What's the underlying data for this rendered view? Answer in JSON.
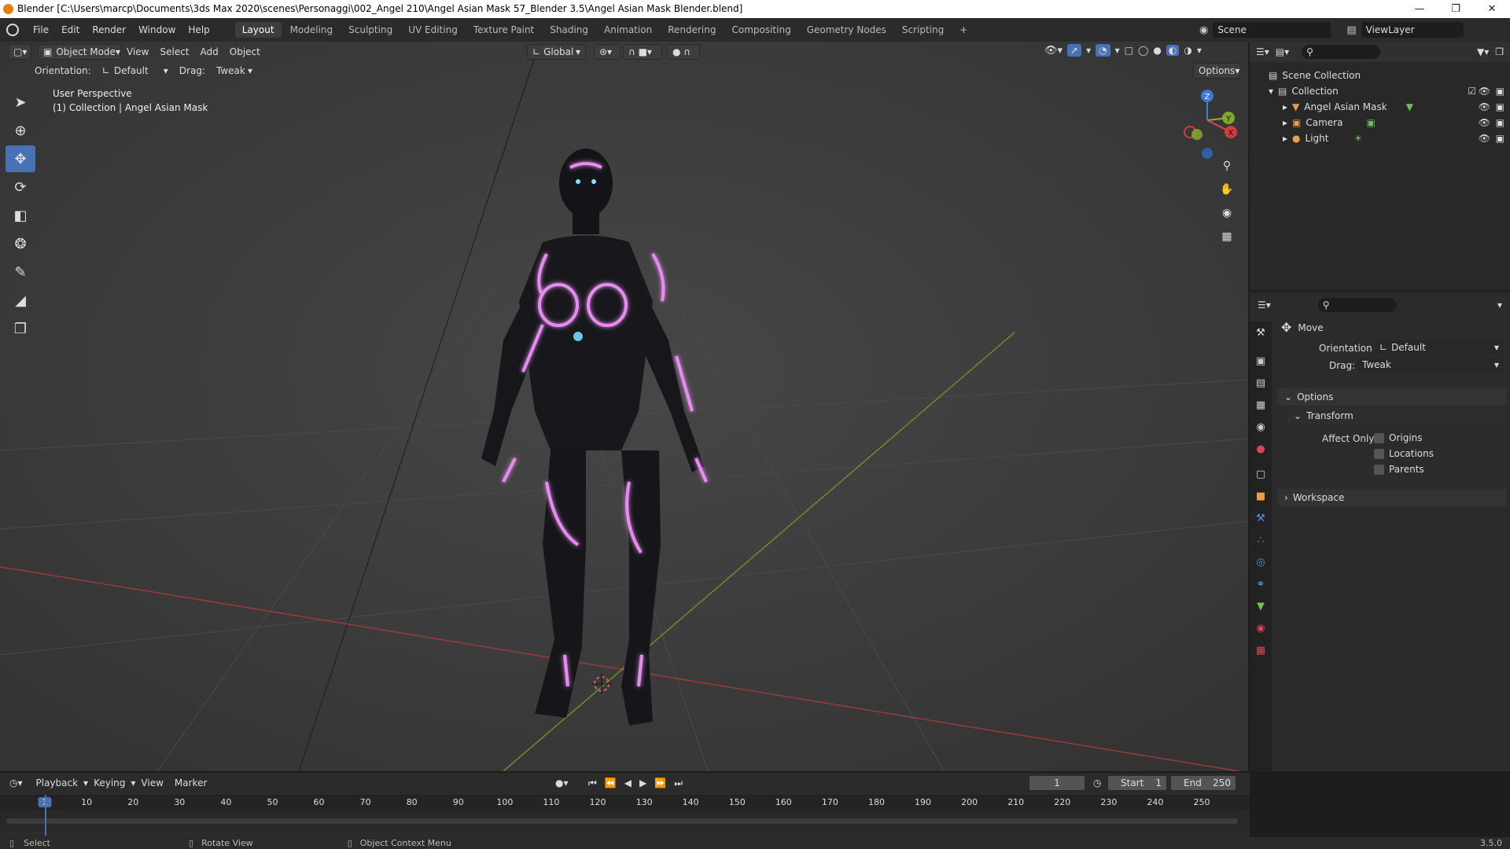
{
  "window": {
    "title": "Blender [C:\\Users\\marcp\\Documents\\3ds Max 2020\\scenes\\Personaggi\\002_Angel 210\\Angel Asian Mask 57_Blender 3.5\\Angel Asian Mask Blender.blend]"
  },
  "menu": {
    "items": [
      "File",
      "Edit",
      "Render",
      "Window",
      "Help"
    ],
    "workspaces": [
      "Layout",
      "Modeling",
      "Sculpting",
      "UV Editing",
      "Texture Paint",
      "Shading",
      "Animation",
      "Rendering",
      "Compositing",
      "Geometry Nodes",
      "Scripting",
      "+"
    ],
    "active_workspace": "Layout",
    "scene": "Scene",
    "view_layer": "ViewLayer"
  },
  "viewport": {
    "mode": "Object Mode",
    "menus": [
      "View",
      "Select",
      "Add",
      "Object"
    ],
    "transform_orientation": "Global",
    "options_label": "Options",
    "orientation_label": "Orientation:",
    "orientation_value": "Default",
    "drag_label": "Drag:",
    "drag_value": "Tweak",
    "perspective": "User Perspective",
    "collection_info": "(1) Collection | Angel Asian Mask",
    "gizmo": {
      "z": "Z",
      "y": "Y",
      "x": "X"
    }
  },
  "outliner": {
    "root": "Scene Collection",
    "collection": "Collection",
    "objects": [
      "Angel Asian Mask",
      "Camera",
      "Light"
    ]
  },
  "properties": {
    "tool_name": "Move",
    "orientation_label": "Orientation",
    "orientation_value": "Default",
    "drag_label": "Drag:",
    "drag_value": "Tweak",
    "options_section": "Options",
    "transform_section": "Transform",
    "affect_only_label": "Affect Only",
    "affect_options": [
      "Origins",
      "Locations",
      "Parents"
    ],
    "workspace_section": "Workspace"
  },
  "timeline": {
    "menus": [
      "Playback",
      "Keying",
      "View",
      "Marker"
    ],
    "current_frame": "1",
    "start_label": "Start",
    "start_value": "1",
    "end_label": "End",
    "end_value": "250",
    "ticks": [
      "1",
      "10",
      "20",
      "30",
      "40",
      "50",
      "60",
      "70",
      "80",
      "90",
      "100",
      "110",
      "120",
      "130",
      "140",
      "150",
      "160",
      "170",
      "180",
      "190",
      "200",
      "210",
      "220",
      "230",
      "240",
      "250"
    ]
  },
  "status": {
    "select": "Select",
    "rotate": "Rotate View",
    "context": "Object Context Menu",
    "version": "3.5.0"
  }
}
